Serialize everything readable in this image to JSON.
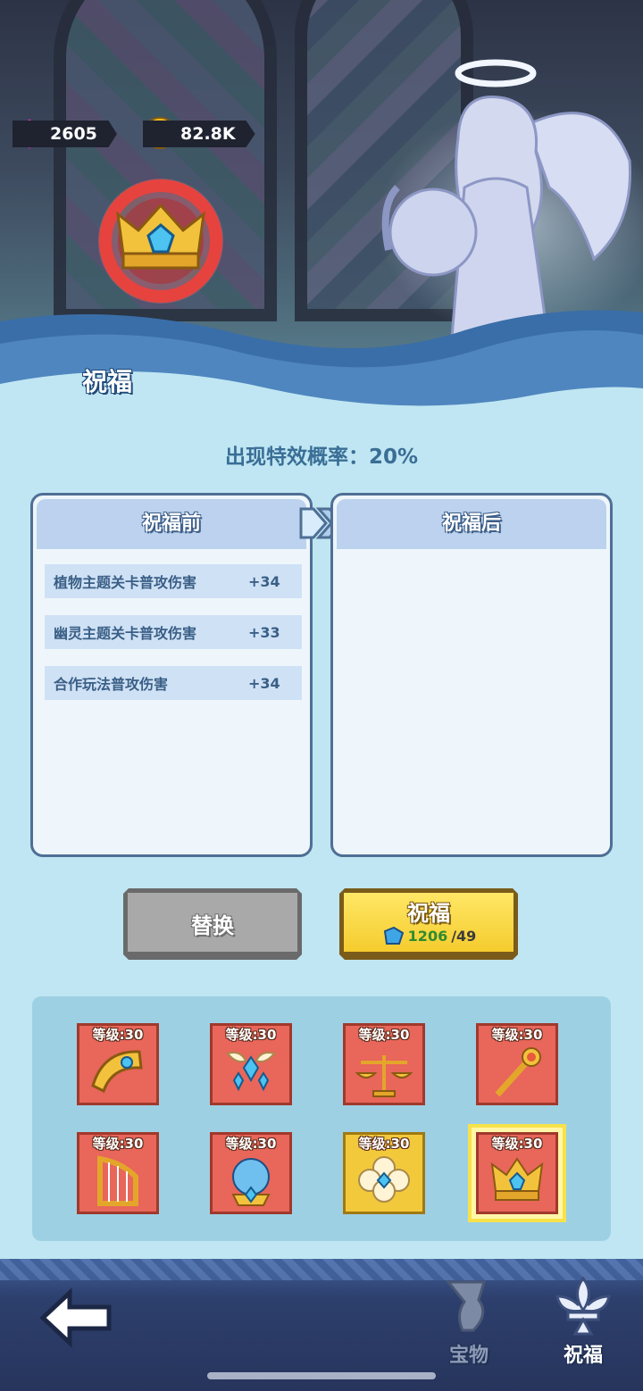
{
  "currencies": [
    {
      "name": "gem",
      "value": "2605"
    },
    {
      "name": "coin",
      "value": "82.8K"
    }
  ],
  "page_title": "祝福",
  "chance_text": "出现特效概率：20%",
  "before_panel": {
    "title": "祝福前",
    "stats": [
      {
        "name": "植物主题关卡普攻伤害",
        "value": "+34"
      },
      {
        "name": "幽灵主题关卡普攻伤害",
        "value": "+33"
      },
      {
        "name": "合作玩法普攻伤害",
        "value": "+34"
      }
    ]
  },
  "after_panel": {
    "title": "祝福后"
  },
  "buttons": {
    "replace_label": "替换",
    "bless_label": "祝福",
    "bless_cost_have": "1206",
    "bless_cost_need": "/49"
  },
  "treasures": [
    {
      "level": "等级:30",
      "icon": "horn-icon",
      "rarity": "red"
    },
    {
      "level": "等级:30",
      "icon": "winged-earrings-icon",
      "rarity": "red"
    },
    {
      "level": "等级:30",
      "icon": "balance-scale-icon",
      "rarity": "red"
    },
    {
      "level": "等级:30",
      "icon": "scepter-icon",
      "rarity": "red"
    },
    {
      "level": "等级:30",
      "icon": "harp-icon",
      "rarity": "red"
    },
    {
      "level": "等级:30",
      "icon": "crystal-orb-icon",
      "rarity": "red"
    },
    {
      "level": "等级:30",
      "icon": "flower-charm-icon",
      "rarity": "gold"
    },
    {
      "level": "等级:30",
      "icon": "crown-icon",
      "rarity": "red",
      "selected": true
    }
  ],
  "nav": {
    "treasure_label": "宝物",
    "bless_label": "祝福"
  },
  "colors": {
    "panel_border": "#4f6f95",
    "stat_text": "#3a5f86",
    "bless_button": "#f5cc2e",
    "tile_red": "#e8665a",
    "tile_gold": "#f3c93c"
  }
}
